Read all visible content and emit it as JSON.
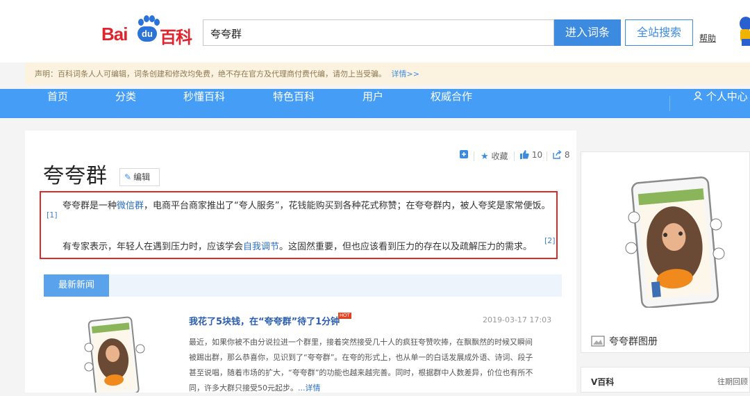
{
  "header": {
    "logo_bai": "Bai",
    "logo_du": "du",
    "logo_baike": "百科",
    "search_value": "夸夸群",
    "enter_button": "进入词条",
    "all_search_button": "全站搜索",
    "help_link": "帮助"
  },
  "notice": {
    "text": "声明：百科词条人人可编辑，词条创建和修改均免费，绝不存在官方及代理商付费代编，请勿上当受骗。",
    "more_link": "详情>>"
  },
  "nav": {
    "items": [
      "首页",
      "分类",
      "秒懂百科",
      "特色百科",
      "用户",
      "权威合作"
    ],
    "user_center": "个人中心"
  },
  "article": {
    "title": "夸夸群",
    "edit_label": "编辑",
    "favorite_label": "收藏",
    "like_count": "10",
    "share_count": "8",
    "para1_before": "夸夸群是一种",
    "para1_link": "微信群",
    "para1_after": "，电商平台商家推出了“夸人服务”，花钱能购买到各种花式称赞；在夸夸群内，被人夸奖是家常便饭。",
    "ref1": "[1]",
    "para2_before": "有专家表示，年轻人在遇到压力时，应该学会",
    "para2_link": "自我调节",
    "para2_after": "。这固然重要，但也应该看到压力的存在以及疏解压力的需求。",
    "ref2": "[2]"
  },
  "news": {
    "tab_label": "最新新闻",
    "title": "我花了5块钱，在“夸夸群”待了1分钟",
    "hot_badge": "HOT",
    "date": "2019-03-17 17:03",
    "line1": "最近，如果你被不由分说拉进一个群里，接着突然接受几十人的疯狂夸赞吹捧，在飘飘然的时候又瞬间",
    "line2": "被踢出群，那么恭喜你，见识到了“夸夸群”。在夸的形式上，也从单一的白话发展成外语、诗词、段子",
    "line3": "甚至说唱，随着市场的扩大，“夸夸群”的功能也越来越完善。同时，根据群中人数差异，价位也有所不",
    "line4": "同，许多大群只接受50元起步。",
    "more_link": "...详情"
  },
  "side": {
    "album_label": "夸夸群图册",
    "vbaike_title": "V百科",
    "vbaike_right": "往期回顾"
  },
  "colors": {
    "nav_blue": "#459df5",
    "brand_red": "#e1242b",
    "link_blue": "#2a6fc9",
    "highlight_red": "#e02a2a"
  }
}
